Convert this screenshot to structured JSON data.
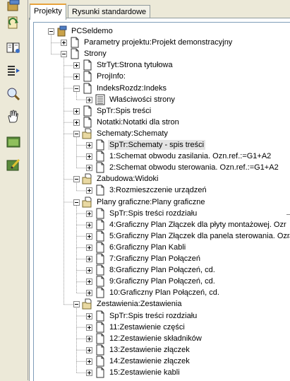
{
  "tabs": [
    {
      "label": "Projekty",
      "active": true
    },
    {
      "label": "Rysunki standardowe",
      "active": false
    }
  ],
  "toolbar": [
    {
      "icon": "project-icon"
    },
    {
      "icon": "rotate-icon"
    },
    {
      "icon": "book-icon"
    },
    {
      "icon": "list-arrow-icon"
    },
    {
      "icon": "zoom-icon"
    },
    {
      "icon": "pan-hand-icon"
    },
    {
      "icon": "window-icon"
    },
    {
      "icon": "edit-icon"
    }
  ],
  "tree": [
    {
      "level": 0,
      "label": "PCSeldemo",
      "type": "project",
      "expander": "minus"
    },
    {
      "level": 1,
      "label": "Parametry projektu:Projekt demonstracyjny",
      "type": "page",
      "expander": "plus"
    },
    {
      "level": 1,
      "label": "Strony",
      "type": "page",
      "expander": "minus"
    },
    {
      "level": 2,
      "label": "StrTyt:Strona tytułowa",
      "type": "page",
      "expander": "plus"
    },
    {
      "level": 2,
      "label": "ProjInfo:",
      "type": "page",
      "expander": "plus"
    },
    {
      "level": 2,
      "label": "IndeksRozdz:Indeks",
      "type": "page",
      "expander": "minus"
    },
    {
      "level": 3,
      "label": "Właściwości strony",
      "type": "props",
      "expander": "plus"
    },
    {
      "level": 2,
      "label": "SpTr:Spis treści",
      "type": "page",
      "expander": "plus"
    },
    {
      "level": 2,
      "label": "Notatki:Notatki dla stron",
      "type": "page",
      "expander": "plus"
    },
    {
      "level": 2,
      "label": "Schematy:Schematy",
      "type": "folder",
      "expander": "minus"
    },
    {
      "level": 3,
      "label": "SpTr:Schematy - spis treści",
      "type": "page",
      "expander": "plus",
      "selected": true
    },
    {
      "level": 3,
      "label": "1:Schemat obwodu zasilania. Ozn.ref.:=G1+A2",
      "type": "page",
      "expander": "plus"
    },
    {
      "level": 3,
      "label": "2:Schemat obwodu sterowania. Ozn.ref.:=G1+A2",
      "type": "page",
      "expander": "plus"
    },
    {
      "level": 2,
      "label": "Zabudowa:Widoki",
      "type": "folder",
      "expander": "minus"
    },
    {
      "level": 3,
      "label": "3:Rozmieszczenie urządzeń",
      "type": "page",
      "expander": "plus"
    },
    {
      "level": 2,
      "label": "Plany graficzne:Plany graficzne",
      "type": "folder",
      "expander": "minus"
    },
    {
      "level": 3,
      "label": "SpTr:Spis treści rozdziału",
      "type": "page",
      "expander": "plus"
    },
    {
      "level": 3,
      "label": "4:Graficzny Plan Złączek dla płyty montażowej. Ozr",
      "type": "page",
      "expander": "plus"
    },
    {
      "level": 3,
      "label": "5:Graficzny Plan Złączek dla panela sterowania. Ozr",
      "type": "page",
      "expander": "plus"
    },
    {
      "level": 3,
      "label": "6:Graficzny Plan Kabli",
      "type": "page",
      "expander": "plus"
    },
    {
      "level": 3,
      "label": "7:Graficzny Plan Połączeń",
      "type": "page",
      "expander": "plus"
    },
    {
      "level": 3,
      "label": "8:Graficzny Plan Połączeń, cd.",
      "type": "page",
      "expander": "plus"
    },
    {
      "level": 3,
      "label": "9:Graficzny Plan Połączeń, cd.",
      "type": "page",
      "expander": "plus"
    },
    {
      "level": 3,
      "label": "10:Graficzny Plan Połączeń, cd.",
      "type": "page",
      "expander": "plus"
    },
    {
      "level": 2,
      "label": "Zestawienia:Zestawienia",
      "type": "folder",
      "expander": "minus"
    },
    {
      "level": 3,
      "label": "SpTr:Spis treści rozdziału",
      "type": "page",
      "expander": "plus"
    },
    {
      "level": 3,
      "label": "11:Zestawienie części",
      "type": "page",
      "expander": "plus"
    },
    {
      "level": 3,
      "label": "12:Zestawienie składników",
      "type": "page",
      "expander": "plus"
    },
    {
      "level": 3,
      "label": "13:Zestawienie złączek",
      "type": "page",
      "expander": "plus"
    },
    {
      "level": 3,
      "label": "14:Zestawienie złączek",
      "type": "page",
      "expander": "plus"
    },
    {
      "level": 3,
      "label": "15:Zestawienie kabli",
      "type": "page",
      "expander": "plus"
    }
  ],
  "colors": {
    "selection": "#e4e4e4",
    "tab_accent": "#e8a33c"
  }
}
